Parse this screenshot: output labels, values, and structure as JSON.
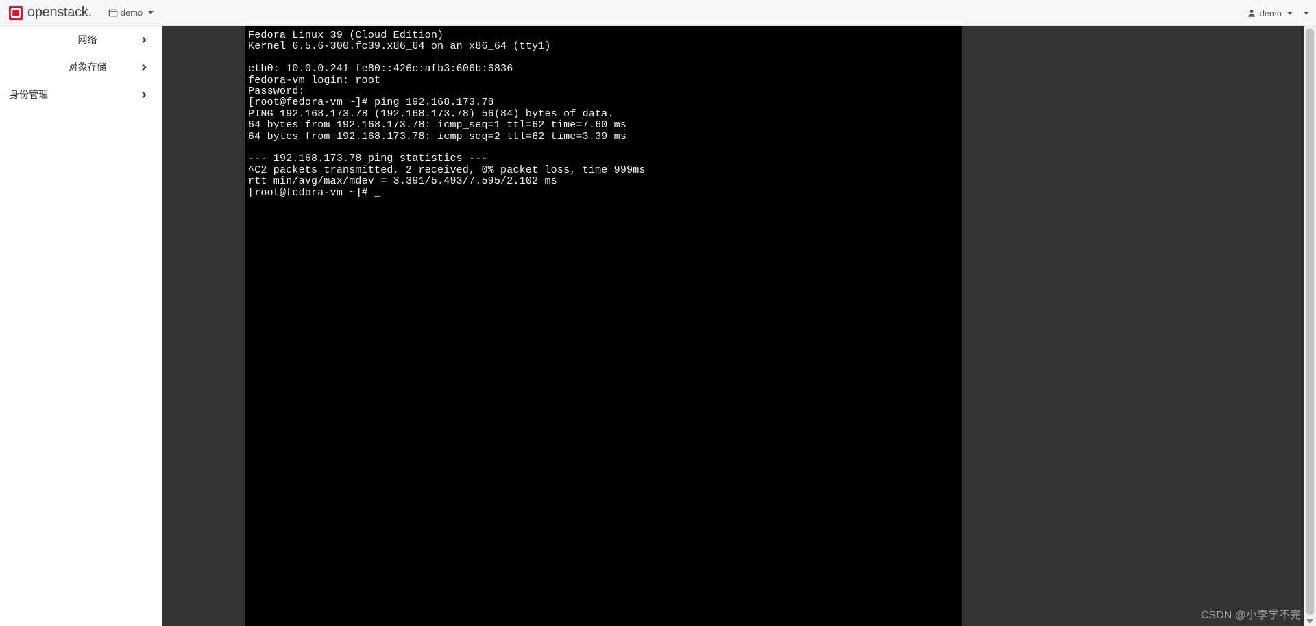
{
  "topbar": {
    "brand": "openstack.",
    "project_selector": "demo",
    "user_menu": "demo"
  },
  "sidebar": {
    "items": [
      {
        "label": "网络"
      },
      {
        "label": "对象存储"
      },
      {
        "label": "身份管理"
      }
    ]
  },
  "console": {
    "lines": [
      "Fedora Linux 39 (Cloud Edition)",
      "Kernel 6.5.6-300.fc39.x86_64 on an x86_64 (tty1)",
      "",
      "eth0: 10.0.0.241 fe80::426c:afb3:606b:6836",
      "fedora-vm login: root",
      "Password:",
      "[root@fedora-vm ~]# ping 192.168.173.78",
      "PING 192.168.173.78 (192.168.173.78) 56(84) bytes of data.",
      "64 bytes from 192.168.173.78: icmp_seq=1 ttl=62 time=7.60 ms",
      "64 bytes from 192.168.173.78: icmp_seq=2 ttl=62 time=3.39 ms",
      "",
      "--- 192.168.173.78 ping statistics ---",
      "^C2 packets transmitted, 2 received, 0% packet loss, time 999ms",
      "rtt min/avg/max/mdev = 3.391/5.493/7.595/2.102 ms",
      "[root@fedora-vm ~]# _"
    ]
  },
  "watermark": "CSDN @小李学不完"
}
